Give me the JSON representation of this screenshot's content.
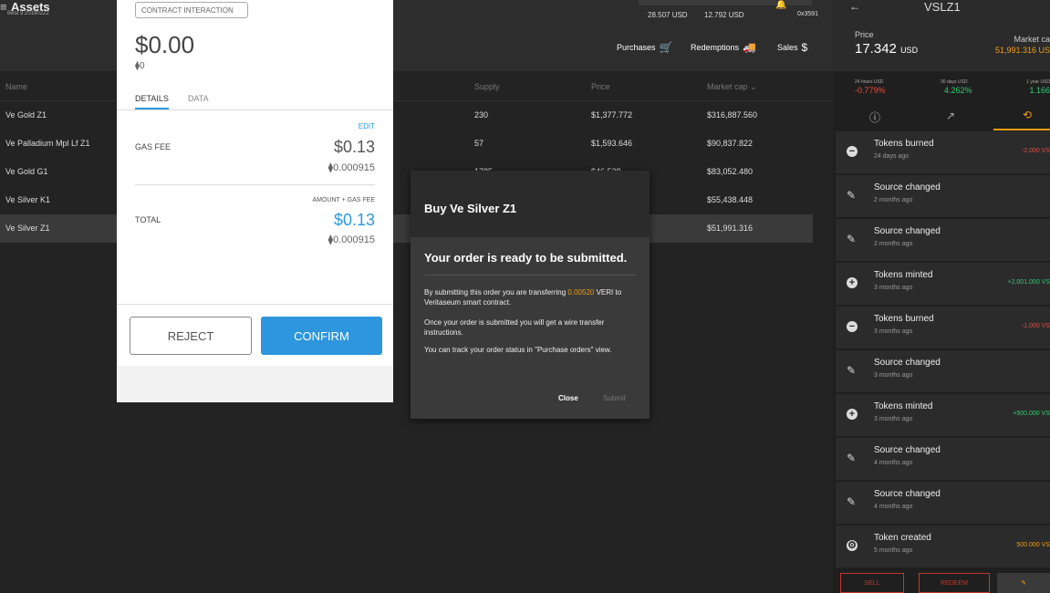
{
  "app": {
    "title": "Assets",
    "version": "Beta 9.20190222",
    "stat1": "28.507 USD",
    "stat2": "12.792 USD",
    "address": "0x3591",
    "nav": {
      "purchases": "Purchases",
      "redemptions": "Redemptions",
      "sales": "Sales"
    }
  },
  "table": {
    "columns": {
      "name": "Name",
      "supply": "Supply",
      "price": "Price",
      "market_cap": "Market cap ⌄"
    },
    "rows": [
      {
        "name": "Ve Gold Z1",
        "supply": "230",
        "price": "$1,377.772",
        "market_cap": "$316,887.560"
      },
      {
        "name": "Ve Palladium Mpl Lf Z1",
        "supply": "57",
        "price": "$1,593.646",
        "market_cap": "$90,837.822"
      },
      {
        "name": "Ve Gold G1",
        "supply": "1785",
        "price": "$46.528",
        "market_cap": "$83,052.480"
      },
      {
        "name": "Ve Silver K1",
        "supply": "",
        "price": "",
        "market_cap": "$55,438.448"
      },
      {
        "name": "Ve Silver Z1",
        "supply": "",
        "price": "",
        "market_cap": "$51,991.316"
      }
    ]
  },
  "contract": {
    "chip": "CONTRACT INTERACTION",
    "amount": "$0.00",
    "eth": "⧫0",
    "tab_details": "DETAILS",
    "tab_data": "DATA",
    "edit": "EDIT",
    "gas_label": "GAS FEE",
    "gas_usd": "$0.13",
    "gas_eth": "⧫0.000915",
    "total_caption": "AMOUNT + GAS FEE",
    "total_label": "TOTAL",
    "total_usd": "$0.13",
    "total_eth": "⧫0.000915",
    "reject": "REJECT",
    "confirm": "CONFIRM"
  },
  "buy_modal": {
    "title": "Buy Ve Silver Z1",
    "heading": "Your order is ready to be submitted.",
    "para1_a": "By submitting this order you are transferring",
    "para1_amount": "0.00520",
    "para1_b": "VERI to Veritaseum smart contract.",
    "para2": "Once your order is submitted you will get a wire transfer instructions.",
    "para3": "You can track your order status in \"Purchase orders\" view.",
    "close": "Close",
    "submit": "Submit"
  },
  "right_panel": {
    "asset": "VSLZ1",
    "price_label": "Price",
    "price_value": "17.342",
    "price_unit": "USD",
    "mcap_label": "Market ca",
    "mcap_value": "51,991.316 US",
    "h24_label": "24 hours USD",
    "h24_value": "-0.779%",
    "d30_label": "30 days USD",
    "d30_value": "4.262%",
    "y1_label": "1 year USD",
    "y1_value": "1.166",
    "history": [
      {
        "icon": "minus",
        "title": "Tokens burned",
        "date": "24 days ago",
        "value": "-2.000 VS",
        "tone": "neg"
      },
      {
        "icon": "pencil",
        "title": "Source changed",
        "date": "2 months ago",
        "value": "",
        "tone": ""
      },
      {
        "icon": "pencil",
        "title": "Source changed",
        "date": "2 months ago",
        "value": "",
        "tone": ""
      },
      {
        "icon": "plus",
        "title": "Tokens minted",
        "date": "3 months ago",
        "value": "+2,001.000 VS",
        "tone": "pos"
      },
      {
        "icon": "minus",
        "title": "Tokens burned",
        "date": "3 months ago",
        "value": "-1.000 VS",
        "tone": "neg"
      },
      {
        "icon": "pencil",
        "title": "Source changed",
        "date": "3 months ago",
        "value": "",
        "tone": ""
      },
      {
        "icon": "plus",
        "title": "Tokens minted",
        "date": "3 months ago",
        "value": "+500.000 VS",
        "tone": "pos"
      },
      {
        "icon": "pencil",
        "title": "Source changed",
        "date": "4 months ago",
        "value": "",
        "tone": ""
      },
      {
        "icon": "pencil",
        "title": "Source changed",
        "date": "4 months ago",
        "value": "",
        "tone": ""
      },
      {
        "icon": "gear",
        "title": "Token created",
        "date": "5 months ago",
        "value": "500.000 VS",
        "tone": "orange"
      }
    ],
    "sell": "SELL",
    "redeem": "REDEEM"
  }
}
